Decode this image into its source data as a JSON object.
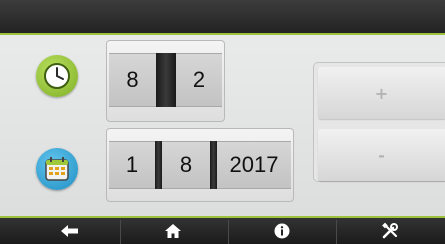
{
  "time": {
    "hour": "8",
    "minute": "2"
  },
  "date": {
    "part1": "1",
    "part2": "8",
    "year": "2017"
  },
  "buttons": {
    "plus": "+",
    "minus": "-"
  },
  "icons": {
    "clock": "clock-icon",
    "calendar": "calendar-icon",
    "back": "back-arrow-icon",
    "home": "home-icon",
    "info": "info-icon",
    "settings": "tools-icon"
  },
  "colors": {
    "accent": "#9cc33b",
    "clock": "#8cbf2f",
    "calendar": "#2fa3d6"
  }
}
